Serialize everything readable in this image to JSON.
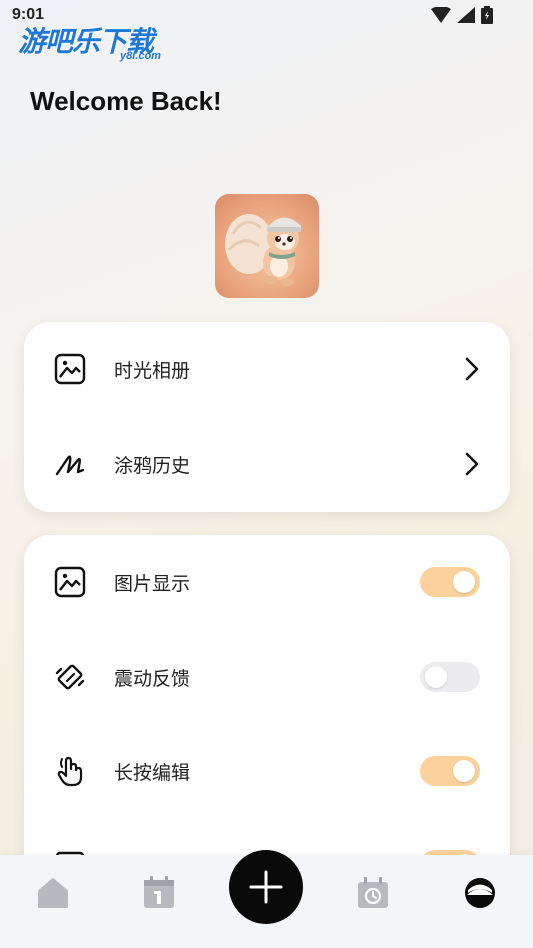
{
  "status": {
    "time": "9:01"
  },
  "watermark": {
    "text": "游吧乐下载",
    "sub": "y8l.com"
  },
  "header": {
    "title": "Welcome Back!"
  },
  "menu": [
    {
      "label": "时光相册",
      "icon": "image-icon"
    },
    {
      "label": "涂鸦历史",
      "icon": "scribble-icon"
    }
  ],
  "settings": [
    {
      "label": "图片显示",
      "icon": "image-icon",
      "enabled": true
    },
    {
      "label": "震动反馈",
      "icon": "vibrate-icon",
      "enabled": false
    },
    {
      "label": "长按编辑",
      "icon": "hand-pointer-icon",
      "enabled": true
    }
  ],
  "nav": {
    "items": [
      "home-icon",
      "calendar-icon",
      "add-icon",
      "alarm-icon",
      "profile-icon"
    ],
    "accent": "#0a0a0a"
  },
  "colors": {
    "toggle_on": "#fcd29c",
    "toggle_off": "#ececef"
  }
}
